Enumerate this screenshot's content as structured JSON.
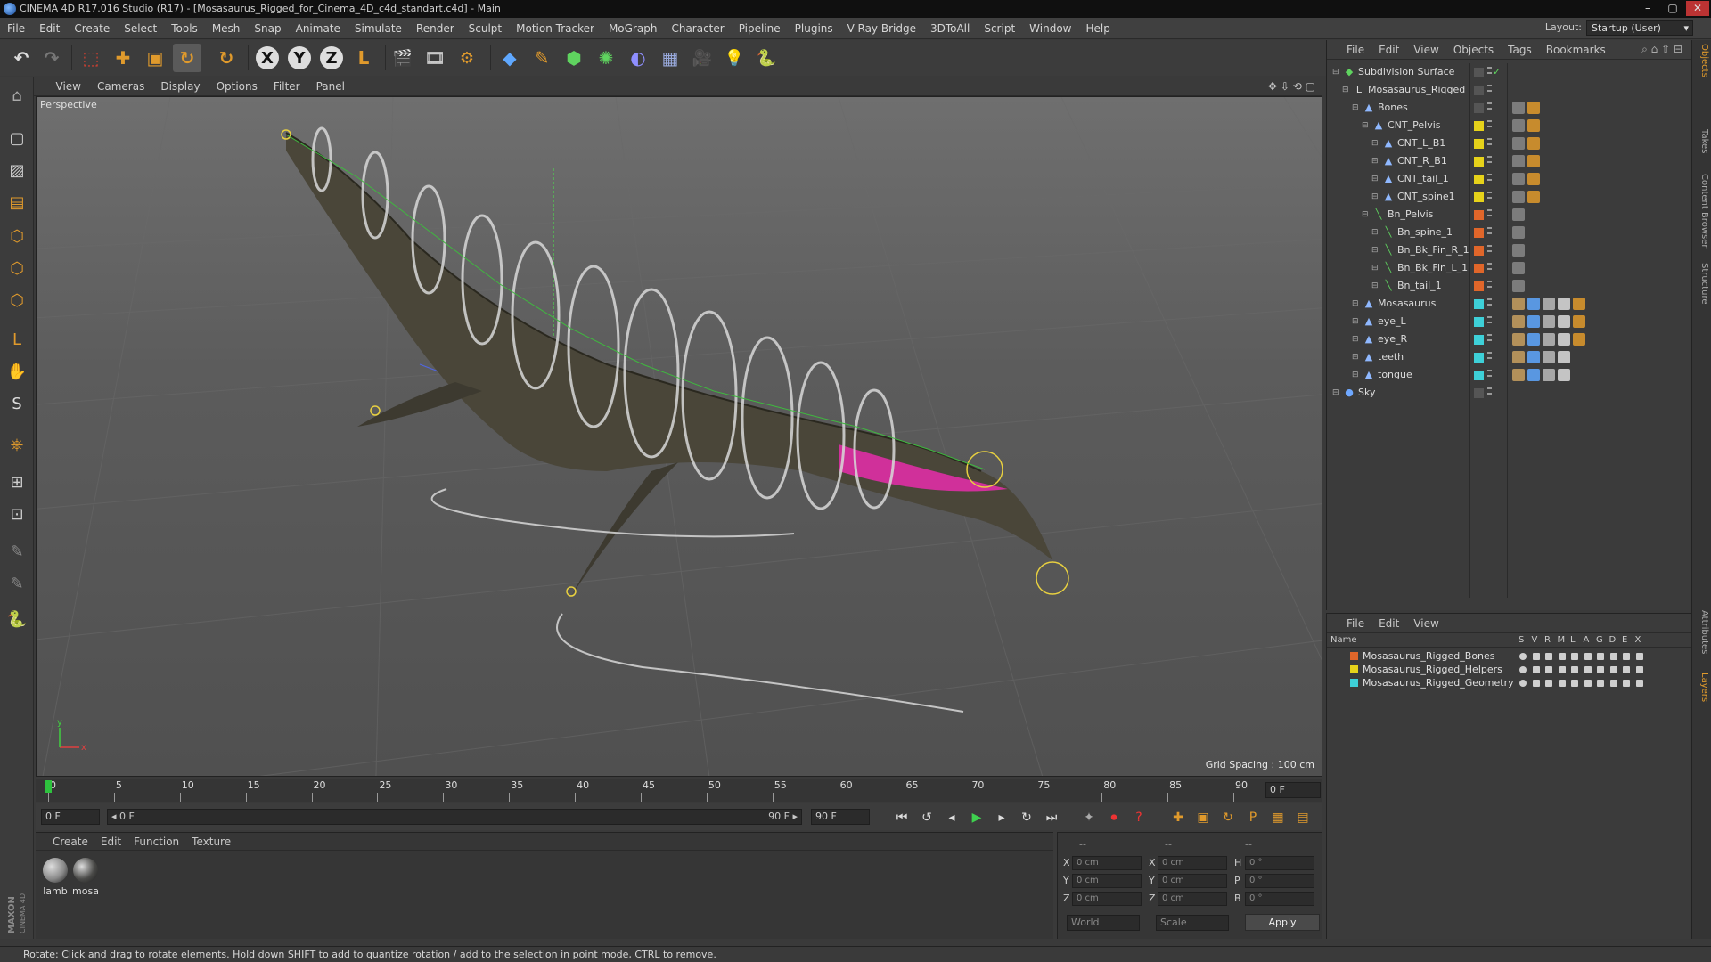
{
  "window": {
    "title": "CINEMA 4D R17.016 Studio (R17) - [Mosasaurus_Rigged_for_Cinema_4D_c4d_standart.c4d] - Main",
    "minimize": "–",
    "maximize": "▢",
    "close": "✕"
  },
  "menu": [
    "File",
    "Edit",
    "Create",
    "Select",
    "Tools",
    "Mesh",
    "Snap",
    "Animate",
    "Simulate",
    "Render",
    "Sculpt",
    "Motion Tracker",
    "MoGraph",
    "Character",
    "Pipeline",
    "Plugins",
    "V-Ray Bridge",
    "3DToAll",
    "Script",
    "Window",
    "Help"
  ],
  "layout": {
    "label": "Layout:",
    "value": "Startup (User)"
  },
  "toolbar": {
    "undo": "↶",
    "redo": "↷",
    "select": "⬚",
    "move": "✚",
    "scale": "▣",
    "rotate": "↻",
    "recent": "↻",
    "x_axis": "X",
    "y_axis": "Y",
    "z_axis": "Z",
    "coord_system": "L",
    "render_view": "🎬",
    "render_pic": "🎞",
    "render_settings": "⚙",
    "cube": "◆",
    "pen": "✎",
    "subdiv": "⬢",
    "array": "✺",
    "deformer": "◐",
    "floor": "▦",
    "camera": "🎥",
    "light": "💡",
    "python": "🐍"
  },
  "left_tools": {
    "make_editable": "⌂",
    "model": "▢",
    "texture": "▨",
    "workplane": "▤",
    "points": "⬡",
    "edges": "⬡",
    "polygons": "⬡",
    "axis": "L",
    "tweak": "✋",
    "solo": "S",
    "magnet": "⎈",
    "snap": "⊞",
    "snap2": "⊡",
    "sculpt1": "✎",
    "sculpt2": "✎",
    "python": "🐍"
  },
  "maxon_logo": "MAXON CINEMA 4D",
  "viewport": {
    "menu": [
      "View",
      "Cameras",
      "Display",
      "Options",
      "Filter",
      "Panel"
    ],
    "label": "Perspective",
    "grid_spacing": "Grid Spacing : 100 cm",
    "axis_x": "x",
    "axis_y": "y",
    "nav_icons": "✥ ⇩ ⟲ ▢"
  },
  "timeline": {
    "ticks": [
      "0",
      "5",
      "10",
      "15",
      "20",
      "25",
      "30",
      "35",
      "40",
      "45",
      "50",
      "55",
      "60",
      "65",
      "70",
      "75",
      "80",
      "85",
      "90"
    ],
    "current_frame": "0 F",
    "playhead_fraction": 0
  },
  "transport": {
    "start_field": "0 F",
    "range_start": "◂ 0 F",
    "range_end": "90 F ▸",
    "end_field": "90 F",
    "buttons": [
      "⏮",
      "↺",
      "◂",
      "▶",
      "▸",
      "↻",
      "⏭"
    ],
    "key_buttons": [
      "✦",
      "⏺",
      "?"
    ],
    "anim_buttons": [
      "✚",
      "▣",
      "↻",
      "P",
      "▦",
      "▤"
    ]
  },
  "material_manager": {
    "menu": [
      "Create",
      "Edit",
      "Function",
      "Texture"
    ],
    "materials": [
      {
        "name": "lamb",
        "color": "#8a8a8a"
      },
      {
        "name": "mosa",
        "color": "#4a4a48"
      }
    ]
  },
  "coordinates": {
    "headers": [
      "--",
      "--",
      "--"
    ],
    "rows": [
      {
        "l1": "X",
        "v1": "0 cm",
        "l2": "X",
        "v2": "0 cm",
        "l3": "H",
        "v3": "0 °"
      },
      {
        "l1": "Y",
        "v1": "0 cm",
        "l2": "Y",
        "v2": "0 cm",
        "l3": "P",
        "v3": "0 °"
      },
      {
        "l1": "Z",
        "v1": "0 cm",
        "l2": "Z",
        "v2": "0 cm",
        "l3": "B",
        "v3": "0 °"
      }
    ],
    "mode1": "World",
    "mode2": "Scale",
    "apply": "Apply"
  },
  "status": "Rotate: Click and drag to rotate elements. Hold down SHIFT to add to quantize rotation / add to the selection in point mode, CTRL to remove.",
  "object_manager": {
    "menu": [
      "File",
      "Edit",
      "View",
      "Objects",
      "Tags",
      "Bookmarks"
    ],
    "objects": [
      {
        "name": "Subdivision Surface",
        "depth": 0,
        "icon": "◆",
        "icon_color": "#5fd35f",
        "color": "#555555",
        "check": "✓"
      },
      {
        "name": "Mosasaurus_Rigged",
        "depth": 1,
        "icon": "L",
        "icon_color": "#dddddd",
        "color": "#555555"
      },
      {
        "name": "Bones",
        "depth": 2,
        "icon": "▲",
        "icon_color": "#8fb8ff",
        "color": "#555555",
        "tags": 2
      },
      {
        "name": "CNT_Pelvis",
        "depth": 3,
        "icon": "▲",
        "icon_color": "#8fb8ff",
        "color": "#e6d21a",
        "tags": 2
      },
      {
        "name": "CNT_L_B1",
        "depth": 4,
        "icon": "▲",
        "icon_color": "#8fb8ff",
        "color": "#e6d21a",
        "tags": 2
      },
      {
        "name": "CNT_R_B1",
        "depth": 4,
        "icon": "▲",
        "icon_color": "#8fb8ff",
        "color": "#e6d21a",
        "tags": 2
      },
      {
        "name": "CNT_tail_1",
        "depth": 4,
        "icon": "▲",
        "icon_color": "#8fb8ff",
        "color": "#e6d21a",
        "tags": 2
      },
      {
        "name": "CNT_spine1",
        "depth": 4,
        "icon": "▲",
        "icon_color": "#8fb8ff",
        "color": "#e6d21a",
        "tags": 2
      },
      {
        "name": "Bn_Pelvis",
        "depth": 3,
        "icon": "╲",
        "icon_color": "#5fd35f",
        "color": "#e0662a",
        "tags": 1
      },
      {
        "name": "Bn_spine_1",
        "depth": 4,
        "icon": "╲",
        "icon_color": "#5fd35f",
        "color": "#e0662a",
        "tags": 1
      },
      {
        "name": "Bn_Bk_Fin_R_1",
        "depth": 4,
        "icon": "╲",
        "icon_color": "#5fd35f",
        "color": "#e0662a",
        "tags": 1
      },
      {
        "name": "Bn_Bk_Fin_L_1",
        "depth": 4,
        "icon": "╲",
        "icon_color": "#5fd35f",
        "color": "#e0662a",
        "tags": 1
      },
      {
        "name": "Bn_tail_1",
        "depth": 4,
        "icon": "╲",
        "icon_color": "#5fd35f",
        "color": "#e0662a",
        "tags": 1
      },
      {
        "name": "Mosasaurus",
        "depth": 2,
        "icon": "▲",
        "icon_color": "#8fb8ff",
        "color": "#3ed0d8",
        "tags": 5
      },
      {
        "name": "eye_L",
        "depth": 2,
        "icon": "▲",
        "icon_color": "#8fb8ff",
        "color": "#3ed0d8",
        "tags": 5
      },
      {
        "name": "eye_R",
        "depth": 2,
        "icon": "▲",
        "icon_color": "#8fb8ff",
        "color": "#3ed0d8",
        "tags": 5
      },
      {
        "name": "teeth",
        "depth": 2,
        "icon": "▲",
        "icon_color": "#8fb8ff",
        "color": "#3ed0d8",
        "tags": 4
      },
      {
        "name": "tongue",
        "depth": 2,
        "icon": "▲",
        "icon_color": "#8fb8ff",
        "color": "#3ed0d8",
        "tags": 4
      },
      {
        "name": "Sky",
        "depth": 0,
        "icon": "●",
        "icon_color": "#6fa8ff",
        "color": "#555555"
      }
    ]
  },
  "layer_manager": {
    "menu": [
      "File",
      "Edit",
      "View"
    ],
    "columns": [
      "Name",
      "S",
      "V",
      "R",
      "M",
      "L",
      "A",
      "G",
      "D",
      "E",
      "X"
    ],
    "layers": [
      {
        "name": "Mosasaurus_Rigged_Bones",
        "color": "#e0662a"
      },
      {
        "name": "Mosasaurus_Rigged_Helpers",
        "color": "#e6d21a"
      },
      {
        "name": "Mosasaurus_Rigged_Geometry",
        "color": "#3ed0d8"
      }
    ]
  },
  "side_tabs": [
    "Objects",
    "Takes",
    "Content Browser",
    "Structure",
    "Attributes",
    "Layers"
  ]
}
